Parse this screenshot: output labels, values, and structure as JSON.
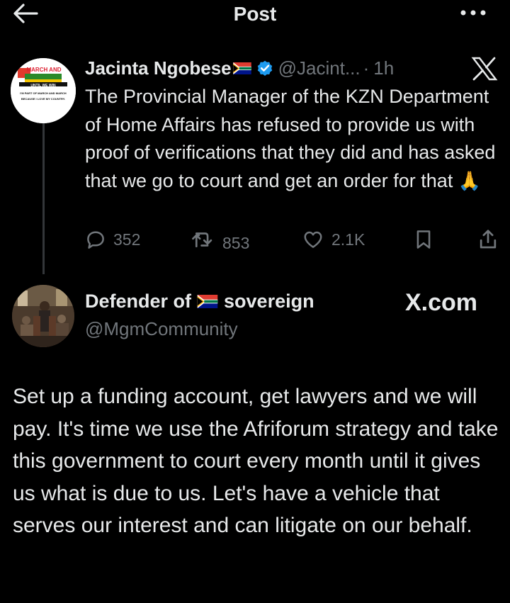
{
  "header": {
    "title": "Post",
    "back_icon": "arrow-left-icon",
    "more_icon": "more-horizontal-icon"
  },
  "original_post": {
    "author_name": "Jacinta Ngobese",
    "handle": "@Jacint...",
    "separator": "·",
    "time": "1h",
    "text": "The Provincial Manager of the KZN Department of Home Affairs has refused to provide us with proof of verifications that they did and has asked that we go to court and get an order for that",
    "emoji": "🙏",
    "avatar_text": {
      "line1": "MARCH AND",
      "line2": "UNTIL WE WIN",
      "line3": "I'M PART OF MARCH AND MARCH",
      "line4": "BECAUSE I LOVE MY COUNTRY."
    },
    "actions": {
      "replies": "352",
      "reposts": "853",
      "likes": "2.1K"
    }
  },
  "reply_post": {
    "author_name_part1": "Defender of",
    "author_name_part2": "sovereign",
    "handle": "@MgmCommunity",
    "watermark": "X.com",
    "text": "Set up a funding account, get lawyers and we will pay. It's time we use the Afriforum strategy and take this government to court every month until it gives us what is due to us. Let's have a vehicle that serves our interest and can litigate on our behalf."
  },
  "colors": {
    "background": "#000000",
    "text_primary": "#e7e9ea",
    "text_secondary": "#71767b",
    "verified": "#1d9bf0"
  }
}
